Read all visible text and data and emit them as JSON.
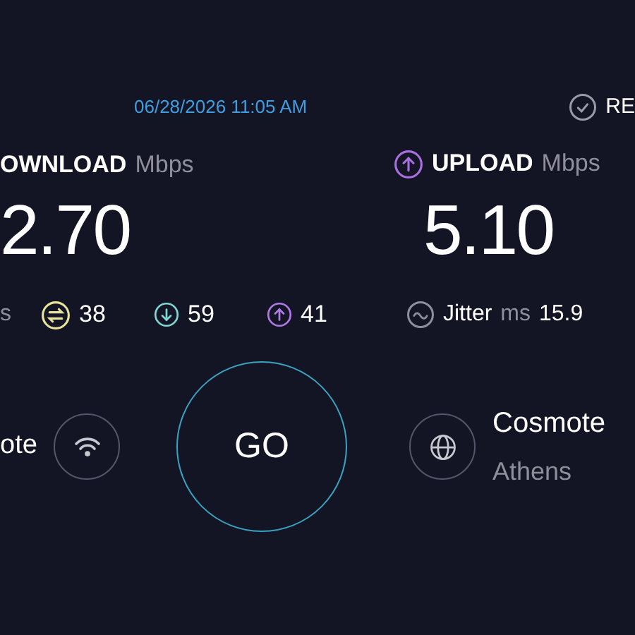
{
  "date": "06/28/2026 11:05 AM",
  "results_link": {
    "label": "RE"
  },
  "download": {
    "label": "OWNLOAD",
    "unit": "Mbps",
    "value": "2.70"
  },
  "upload": {
    "label": "UPLOAD",
    "unit": "Mbps",
    "value": "5.10"
  },
  "ping": {
    "unit": "s",
    "items": [
      {
        "kind": "idle",
        "value": "38"
      },
      {
        "kind": "download",
        "value": "59"
      },
      {
        "kind": "upload",
        "value": "41"
      }
    ]
  },
  "jitter": {
    "label": "Jitter",
    "unit": "ms",
    "value": "15.9"
  },
  "isp": {
    "name": "ote"
  },
  "go_button": {
    "label": "GO"
  },
  "server": {
    "name": "Cosmote",
    "location": "Athens"
  }
}
